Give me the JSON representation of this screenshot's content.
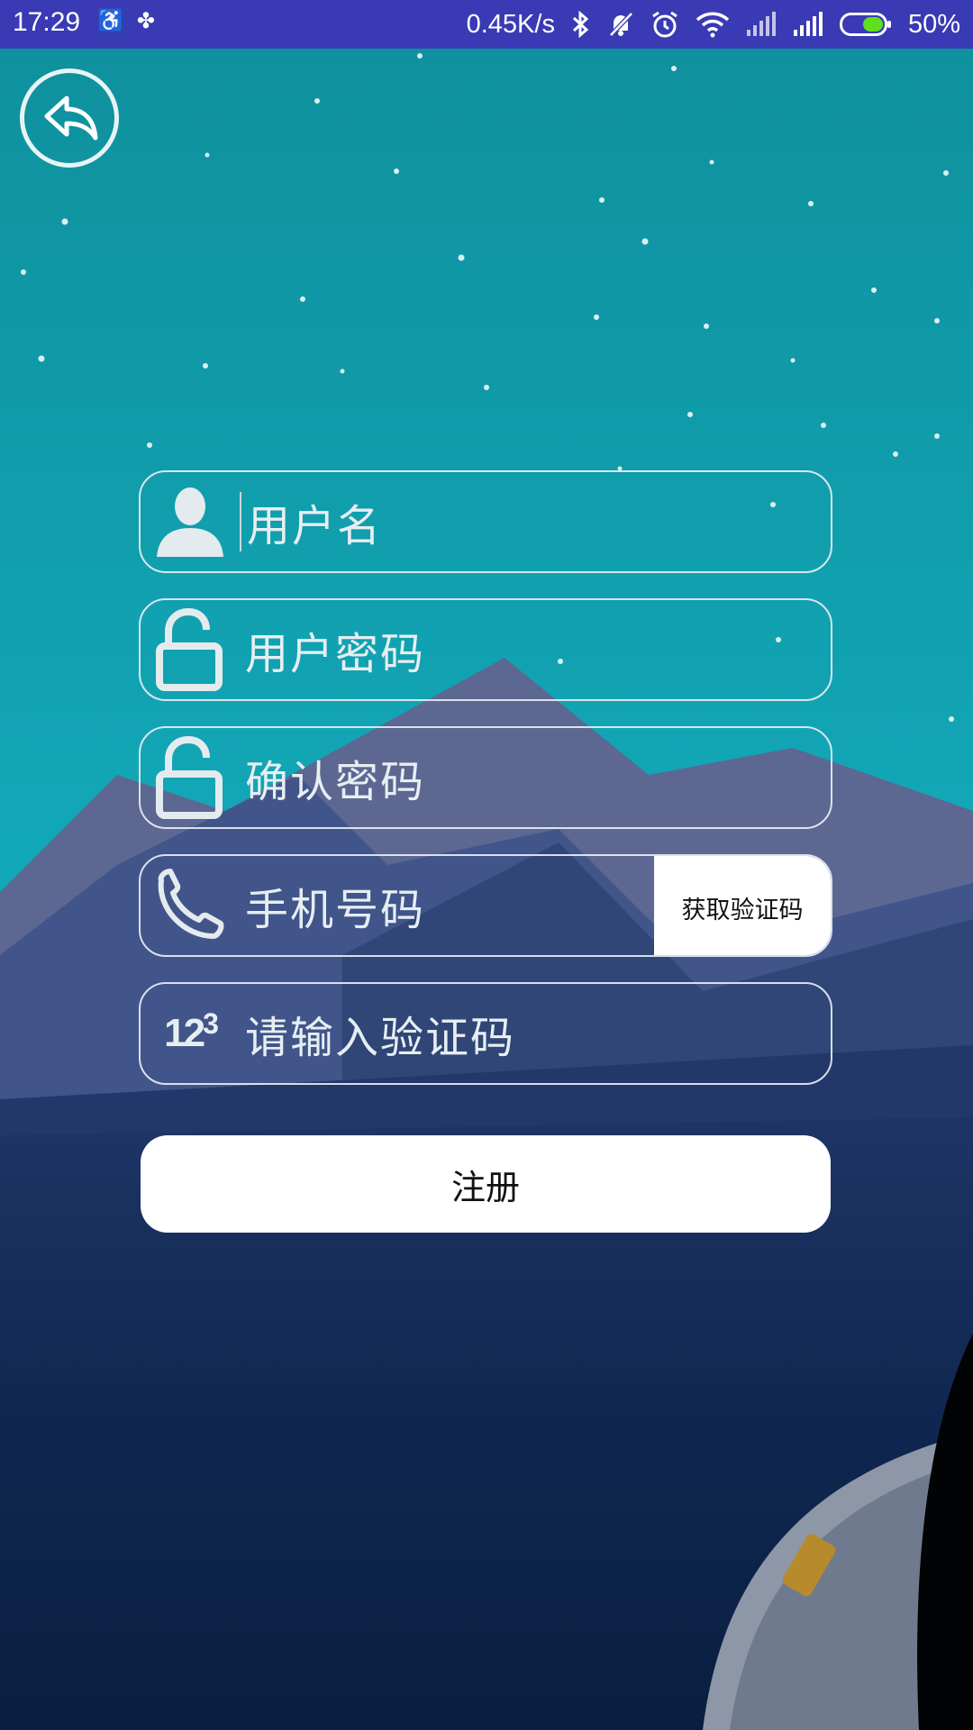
{
  "status_bar": {
    "time": "17:29",
    "network_speed": "0.45K/s",
    "battery_percent": "50%",
    "battery_level": 0.5,
    "icons": [
      "accessibility-icon",
      "sync-icon",
      "bluetooth-icon",
      "mute-icon",
      "alarm-icon",
      "wifi-icon",
      "signal-icon",
      "signal-icon",
      "battery-icon"
    ]
  },
  "back_button": {
    "icon": "back-arrow-icon"
  },
  "form": {
    "username": {
      "placeholder": "用户名",
      "icon": "user-icon"
    },
    "password": {
      "placeholder": "用户密码",
      "icon": "lock-icon"
    },
    "confirm_password": {
      "placeholder": "确认密码",
      "icon": "lock-icon"
    },
    "phone": {
      "placeholder": "手机号码",
      "icon": "phone-icon",
      "get_code_label": "获取验证码"
    },
    "verification_code": {
      "placeholder": "请输入验证码",
      "icon": "number-123-icon",
      "icon_text": "12",
      "icon_sup": "3"
    },
    "submit_label": "注册"
  },
  "colors": {
    "status_bar_bg": "#3a3ab4",
    "sky_top": "#129aa6",
    "sky_bottom": "#13b9c9",
    "mountain_far": "#5c6792",
    "mountain_mid": "#3a4d80",
    "ground_dark": "#0c2446",
    "field_border": "#ebf0f5",
    "button_bg": "#ffffff",
    "battery_fill": "#5fe01c"
  }
}
